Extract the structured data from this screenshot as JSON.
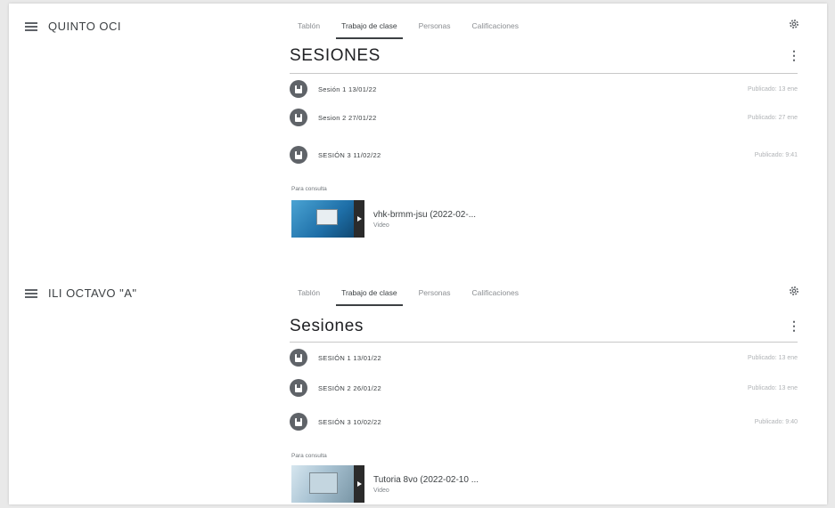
{
  "panels": [
    {
      "course": "QUINTO OCI",
      "tabs": [
        "Tablón",
        "Trabajo de clase",
        "Personas",
        "Calificaciones"
      ],
      "active_tab": 1,
      "topic": "SESIONES",
      "items": [
        {
          "title": "Sesión 1 13/01/22",
          "meta": "Publicado: 13 ene"
        },
        {
          "title": "Sesion 2 27/01/22",
          "meta": "Publicado: 27 ene"
        },
        {
          "title": "SESIÓN 3 11/02/22",
          "meta": "Publicado: 9:41"
        }
      ],
      "section_label": "Para consulta",
      "attachment": {
        "title": "vhk-brmm-jsu (2022-02-...",
        "type": "Video"
      }
    },
    {
      "course": "ILI OCTAVO \"A\"",
      "tabs": [
        "Tablón",
        "Trabajo de clase",
        "Personas",
        "Calificaciones"
      ],
      "active_tab": 1,
      "topic": "Sesiones",
      "items": [
        {
          "title": "SESIÓN 1 13/01/22",
          "meta": "Publicado: 13 ene"
        },
        {
          "title": "SESIÓN 2 26/01/22",
          "meta": "Publicado: 13 ene"
        },
        {
          "title": "SESIÓN 3 10/02/22",
          "meta": "Publicado: 9:40"
        }
      ],
      "section_label": "Para consulta",
      "attachment": {
        "title": "Tutoria 8vo (2022-02-10 ...",
        "type": "Video"
      }
    }
  ],
  "icons": {
    "menu": "hamburger-menu-icon",
    "settings": "gear-icon",
    "more": "more-vert-icon",
    "assignment": "assignment-icon",
    "video": "video-thumbnail"
  },
  "colors": {
    "text": "#3c4043",
    "muted": "#8a8d91",
    "icon_circle": "#5f6368"
  }
}
